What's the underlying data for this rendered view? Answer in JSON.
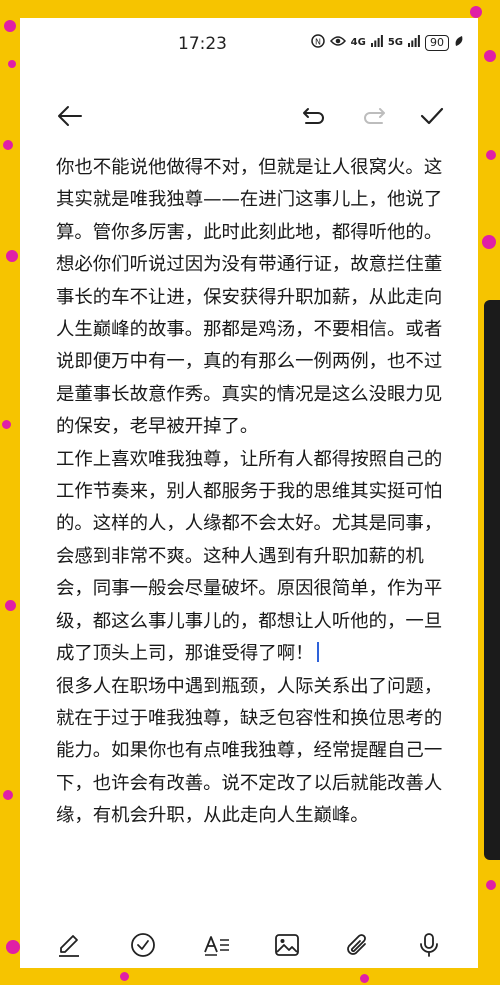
{
  "status": {
    "time": "17:23",
    "net1": "4G",
    "net2": "5G",
    "battery": "90"
  },
  "toolbar": {
    "icons": [
      "back-arrow-icon",
      "undo-icon",
      "redo-icon",
      "check-icon"
    ]
  },
  "note": {
    "paragraphs": [
      "你也不能说他做得不对，但就是让人很窝火。这其实就是唯我独尊——在进门这事儿上，他说了算。管你多厉害，此时此刻此地，都得听他的。",
      "想必你们听说过因为没有带通行证，故意拦住董事长的车不让进，保安获得升职加薪，从此走向人生巅峰的故事。那都是鸡汤，不要相信。或者说即便万中有一，真的有那么一例两例，也不过是董事长故意作秀。真实的情况是这么没眼力见的保安，老早被开掉了。",
      "工作上喜欢唯我独尊，让所有人都得按照自己的工作节奏来，别人都服务于我的思维其实挺可怕的。这样的人，人缘都不会太好。尤其是同事，会感到非常不爽。这种人遇到有升职加薪的机会，同事一般会尽量破坏。原因很简单，作为平级，都这么事儿事儿的，都想让人听他的，一旦成了顶头上司，那谁受得了啊！",
      "很多人在职场中遇到瓶颈，人际关系出了问题，就在于过于唯我独尊，缺乏包容性和换位思考的能力。如果你也有点唯我独尊，经常提醒自己一下，也许会有改善。说不定改了以后就能改善人缘，有机会升职，从此走向人生巅峰。"
    ]
  },
  "bottom": {
    "icons": [
      "pen-icon",
      "checklist-icon",
      "text-format-icon",
      "image-icon",
      "attachment-icon",
      "microphone-icon"
    ]
  },
  "colors": {
    "background": "#f6c400",
    "dots": "#e01fa6",
    "cursor": "#2e62d9"
  }
}
